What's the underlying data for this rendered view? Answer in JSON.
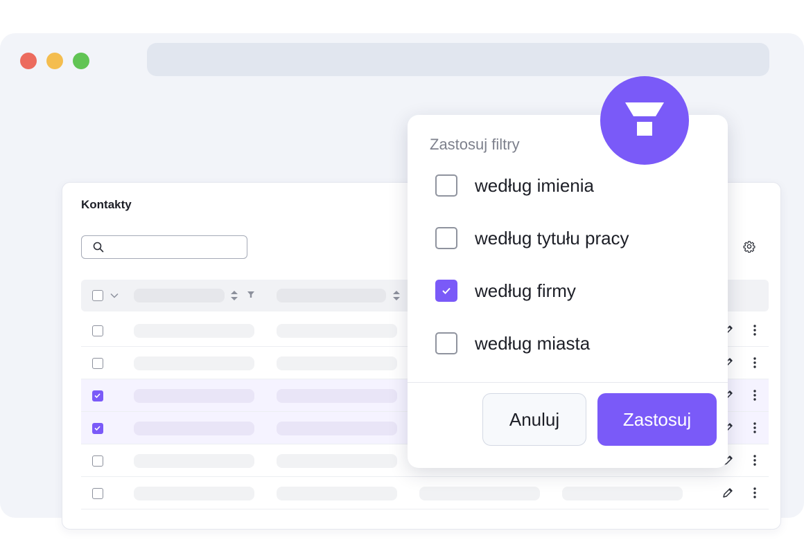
{
  "colors": {
    "accent": "#7a5af8",
    "window_bg": "#f2f4f9",
    "traffic_red": "#ec6b5e",
    "traffic_yellow": "#f4bd4f",
    "traffic_green": "#61c454"
  },
  "contacts": {
    "title": "Kontakty",
    "search": {
      "value": "",
      "icon": "search-icon"
    },
    "settings_icon": "gear-icon",
    "rows": [
      {
        "selected": false
      },
      {
        "selected": false
      },
      {
        "selected": true
      },
      {
        "selected": true
      },
      {
        "selected": false
      },
      {
        "selected": false
      }
    ]
  },
  "filter_popup": {
    "title": "Zastosuj filtry",
    "badge_icon": "funnel-icon",
    "options": [
      {
        "label": "według imienia",
        "checked": false
      },
      {
        "label": "według tytułu pracy",
        "checked": false
      },
      {
        "label": "według firmy",
        "checked": true
      },
      {
        "label": "według miasta",
        "checked": false
      }
    ],
    "cancel_label": "Anuluj",
    "apply_label": "Zastosuj"
  }
}
